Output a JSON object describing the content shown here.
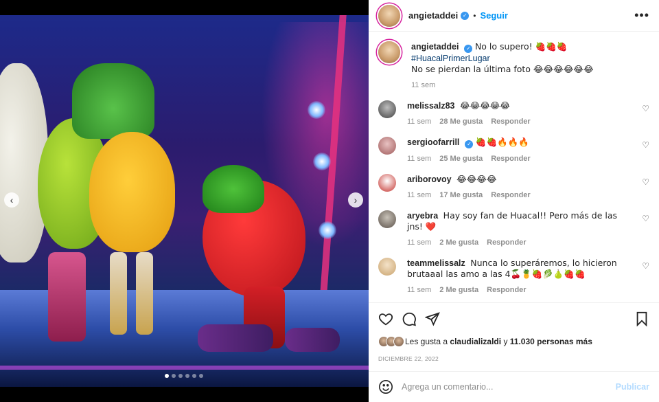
{
  "post": {
    "username": "angietaddei",
    "follow_label": "Seguir",
    "caption_line1": "No lo supero! 🍓🍓🍓",
    "caption_hashtag": "#HuacalPrimerLugar",
    "caption_line2": "No se pierdan la última foto 😂😂😂😂😂😂",
    "caption_time": "11 sem"
  },
  "comments": [
    {
      "user": "melissalz83",
      "text": "😂😂😂😂😂",
      "time": "11 sem",
      "likes": "28 Me gusta",
      "reply": "Responder"
    },
    {
      "user": "sergioofarrill",
      "text": "🍓🍓🔥🔥🔥",
      "time": "11 sem",
      "likes": "25 Me gusta",
      "reply": "Responder"
    },
    {
      "user": "ariborovoy",
      "text": "😂😂😂😂",
      "time": "11 sem",
      "likes": "17 Me gusta",
      "reply": "Responder"
    },
    {
      "user": "aryebra",
      "text": "Hay soy fan de Huacal!! Pero más de las jns! ❤️",
      "time": "11 sem",
      "likes": "2 Me gusta",
      "reply": "Responder"
    },
    {
      "user": "teammelissalz",
      "text": "Nunca lo superáremos, lo hicieron brutaaal las amo a las 4🍒🍍🍓🥬🍐🍓🍓",
      "time": "11 sem",
      "likes": "2 Me gusta",
      "reply": "Responder"
    }
  ],
  "likes": {
    "prefix": "Les gusta a",
    "user": "claudializaldi",
    "connector": "y",
    "count": "11.030 personas más"
  },
  "date": "DICIEMBRE 22, 2022",
  "composer": {
    "placeholder": "Agrega un comentario...",
    "publish_label": "Publicar"
  },
  "carousel": {
    "slide_count": 6,
    "active_index": 0
  },
  "colors": {
    "accent": "#0095f6",
    "publish_disabled": "#b3dbff",
    "heart_red": "#ed4956",
    "verified": "#3897f0"
  }
}
